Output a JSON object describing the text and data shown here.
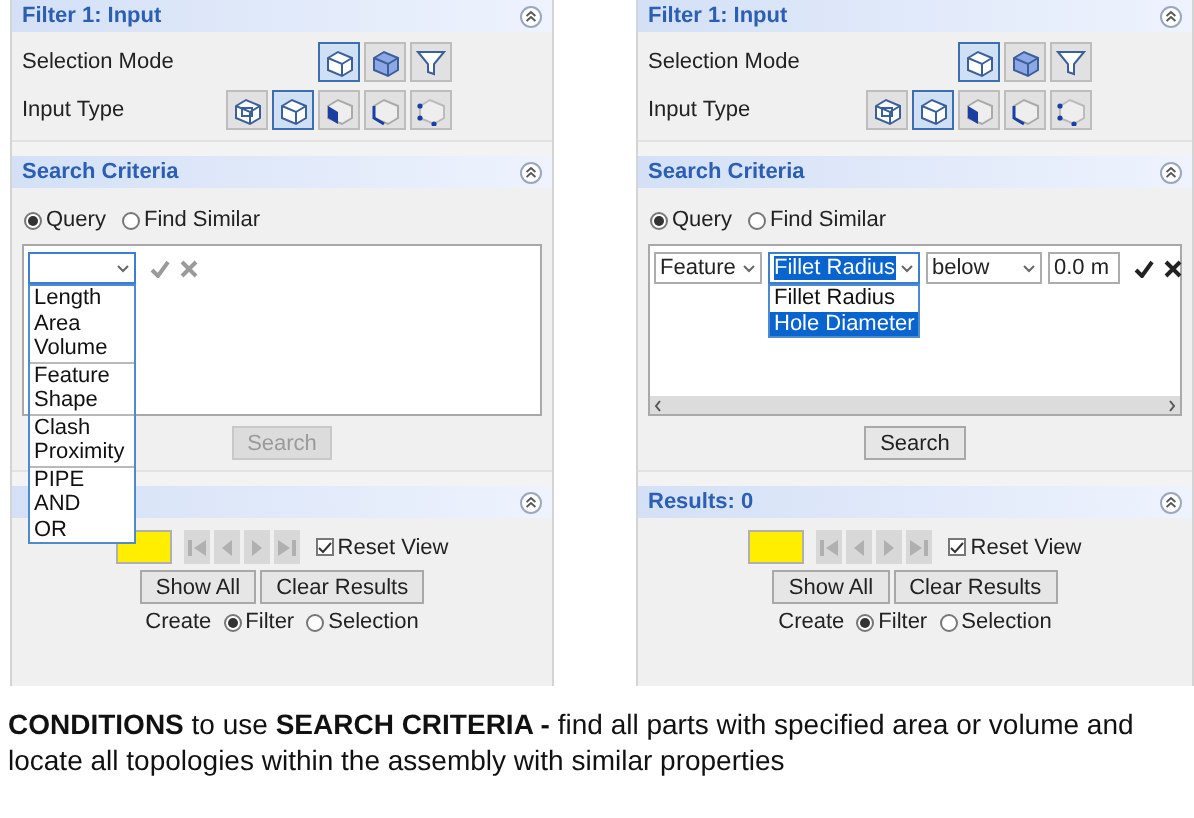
{
  "panels": [
    {
      "input_section": {
        "title": "Filter 1: Input",
        "rows": [
          {
            "label": "Selection Mode",
            "icons": [
              {
                "kind": "solid",
                "selected": true
              },
              {
                "kind": "part",
                "selected": false
              },
              {
                "kind": "funnel",
                "selected": false
              }
            ]
          },
          {
            "label": "Input Type",
            "icons": [
              {
                "kind": "body",
                "selected": false
              },
              {
                "kind": "solid",
                "selected": true
              },
              {
                "kind": "face",
                "selected": false
              },
              {
                "kind": "edge",
                "selected": false
              },
              {
                "kind": "vertex",
                "selected": false
              }
            ]
          }
        ]
      },
      "search_section": {
        "title": "Search Criteria",
        "modes": [
          {
            "label": "Query",
            "selected": true
          },
          {
            "label": "Find Similar",
            "selected": false
          }
        ],
        "query": {
          "fields": [
            {
              "kind": "combo",
              "focused": true,
              "open": true
            }
          ],
          "actions_enabled": false,
          "dropdown": {
            "groups": [
              [
                {
                  "label": "Length",
                  "selected": false
                },
                {
                  "label": "Area",
                  "selected": false
                },
                {
                  "label": "Volume",
                  "selected": false
                }
              ],
              [
                {
                  "label": "Feature",
                  "selected": false
                },
                {
                  "label": "Shape",
                  "selected": false
                }
              ],
              [
                {
                  "label": "Clash",
                  "selected": false
                },
                {
                  "label": "Proximity",
                  "selected": false
                }
              ],
              [
                {
                  "label": "PIPE",
                  "selected": false
                },
                {
                  "label": "AND",
                  "selected": false
                },
                {
                  "label": "OR",
                  "selected": false
                }
              ]
            ]
          }
        },
        "search_button": {
          "label": "Search",
          "disabled": true
        }
      },
      "results_section": {
        "reset_view": {
          "label": "Reset View",
          "checked": true
        },
        "buttons": [
          "Show All",
          "Clear Results"
        ],
        "create": {
          "label": "Create",
          "options": [
            {
              "label": "Filter",
              "selected": true
            },
            {
              "label": "Selection",
              "selected": false
            }
          ]
        }
      }
    },
    {
      "input_section": {
        "title": "Filter 1: Input",
        "rows": [
          {
            "label": "Selection Mode",
            "icons": [
              {
                "kind": "solid",
                "selected": true
              },
              {
                "kind": "part",
                "selected": false
              },
              {
                "kind": "funnel",
                "selected": false
              }
            ]
          },
          {
            "label": "Input Type",
            "icons": [
              {
                "kind": "body",
                "selected": false
              },
              {
                "kind": "solid",
                "selected": true
              },
              {
                "kind": "face",
                "selected": false
              },
              {
                "kind": "edge",
                "selected": false
              },
              {
                "kind": "vertex",
                "selected": false
              }
            ]
          }
        ]
      },
      "search_section": {
        "title": "Search Criteria",
        "modes": [
          {
            "label": "Query",
            "selected": true
          },
          {
            "label": "Find Similar",
            "selected": false
          }
        ],
        "query": {
          "fields": [
            {
              "kind": "combo",
              "value": "Feature",
              "focused": false,
              "open": false
            },
            {
              "kind": "combo",
              "value": "Fillet Radius",
              "focused": true,
              "open": true
            },
            {
              "kind": "combo",
              "value": "below",
              "focused": false,
              "open": false
            },
            {
              "kind": "input",
              "value": "0.0 m"
            }
          ],
          "actions_enabled": true,
          "scrollbar": true,
          "dropdown": {
            "groups": [
              [
                {
                  "label": "Fillet Radius",
                  "selected": false
                },
                {
                  "label": "Hole Diameter",
                  "selected": true
                }
              ]
            ]
          }
        },
        "search_button": {
          "label": "Search",
          "disabled": false
        }
      },
      "results_section": {
        "title": "Results: 0",
        "reset_view": {
          "label": "Reset View",
          "checked": true
        },
        "buttons": [
          "Show All",
          "Clear Results"
        ],
        "create": {
          "label": "Create",
          "options": [
            {
              "label": "Filter",
              "selected": true
            },
            {
              "label": "Selection",
              "selected": false
            }
          ]
        }
      }
    }
  ],
  "caption": "**CONDITIONS** to use **SEARCH CRITERIA -** find all parts with specified area or volume and locate all topologies within the assembly with similar properties"
}
